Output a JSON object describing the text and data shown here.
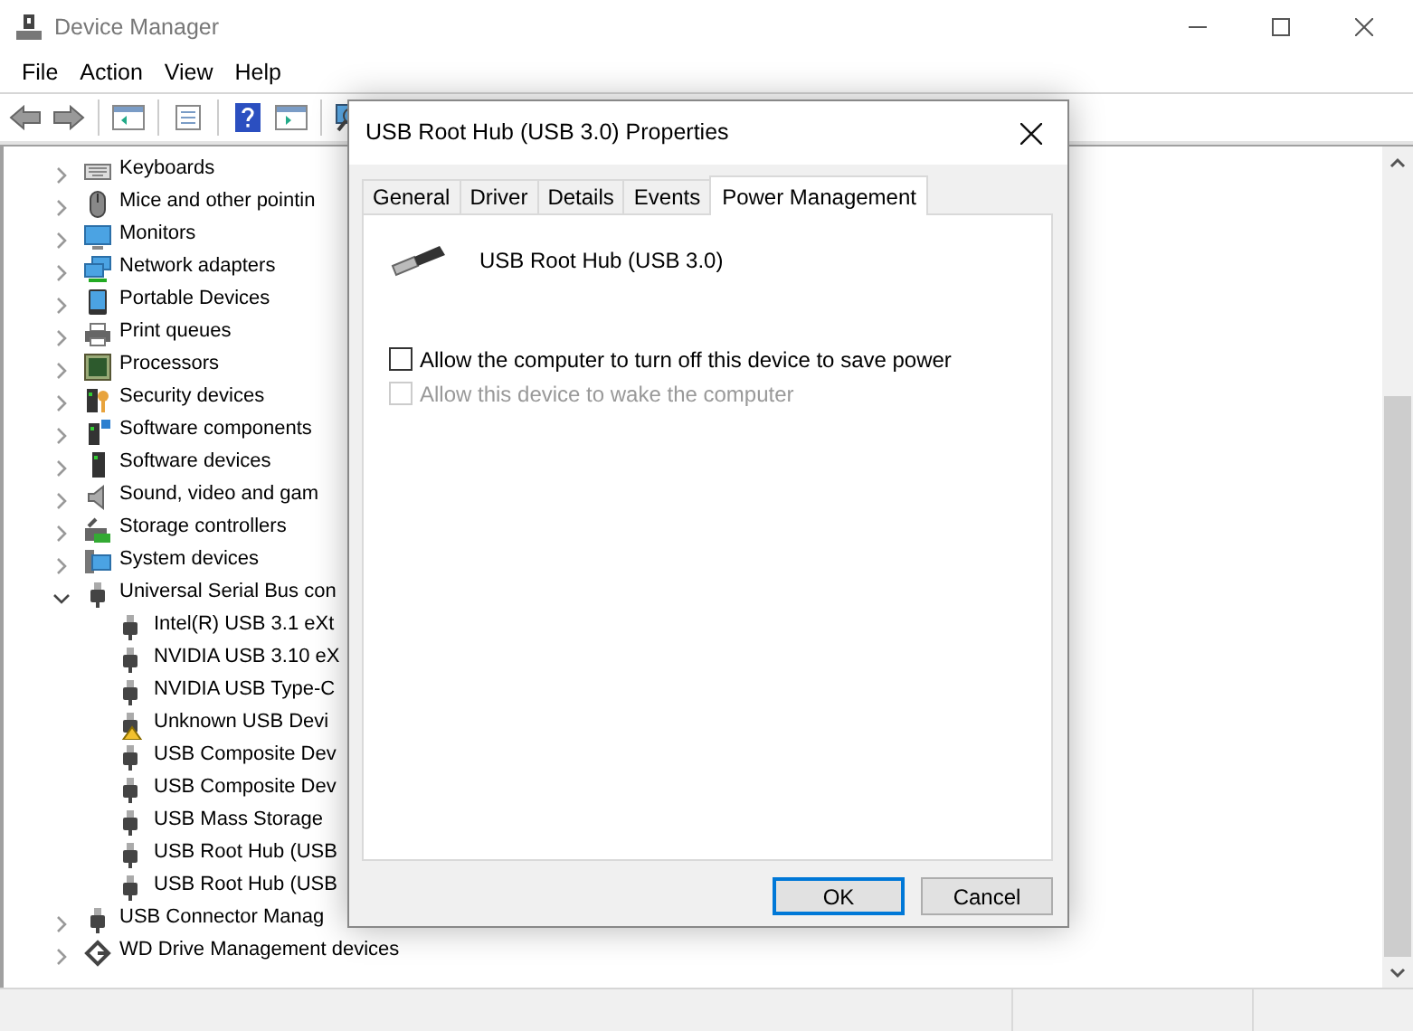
{
  "window": {
    "title": "Device Manager"
  },
  "menu": [
    "File",
    "Action",
    "View",
    "Help"
  ],
  "tree": [
    {
      "label": "Keyboards",
      "expanded": false
    },
    {
      "label": "Mice and other pointin",
      "expanded": false
    },
    {
      "label": "Monitors",
      "expanded": false
    },
    {
      "label": "Network adapters",
      "expanded": false
    },
    {
      "label": "Portable Devices",
      "expanded": false
    },
    {
      "label": "Print queues",
      "expanded": false
    },
    {
      "label": "Processors",
      "expanded": false
    },
    {
      "label": "Security devices",
      "expanded": false
    },
    {
      "label": "Software components",
      "expanded": false
    },
    {
      "label": "Software devices",
      "expanded": false
    },
    {
      "label": "Sound, video and gam",
      "expanded": false
    },
    {
      "label": "Storage controllers",
      "expanded": false
    },
    {
      "label": "System devices",
      "expanded": false
    },
    {
      "label": "Universal Serial Bus con",
      "expanded": true,
      "children": [
        {
          "label": "Intel(R) USB 3.1 eXt",
          "warning": false
        },
        {
          "label": "NVIDIA USB 3.10 eX",
          "warning": false
        },
        {
          "label": "NVIDIA USB Type-C",
          "warning": false
        },
        {
          "label": "Unknown USB Devi",
          "warning": true
        },
        {
          "label": "USB Composite Dev",
          "warning": false
        },
        {
          "label": "USB Composite Dev",
          "warning": false
        },
        {
          "label": "USB Mass Storage",
          "warning": false
        },
        {
          "label": "USB Root Hub (USB",
          "warning": false
        },
        {
          "label": "USB Root Hub (USB",
          "warning": false
        }
      ]
    },
    {
      "label": "USB Connector Manag",
      "expanded": false
    },
    {
      "label": "WD Drive Management devices",
      "expanded": false
    }
  ],
  "dialog": {
    "title": "USB Root Hub (USB 3.0) Properties",
    "tabs": [
      {
        "label": "General",
        "selected": false
      },
      {
        "label": "Driver",
        "selected": false
      },
      {
        "label": "Details",
        "selected": false
      },
      {
        "label": "Events",
        "selected": false
      },
      {
        "label": "Power Management",
        "selected": true
      }
    ],
    "device_name": "USB Root Hub (USB 3.0)",
    "options": [
      {
        "label": "Allow the computer to turn off this device to save power",
        "checked": false,
        "disabled": false
      },
      {
        "label": "Allow this device to wake the computer",
        "checked": false,
        "disabled": true
      }
    ],
    "buttons": [
      {
        "label": "OK",
        "default": true
      },
      {
        "label": "Cancel",
        "default": false
      }
    ]
  }
}
